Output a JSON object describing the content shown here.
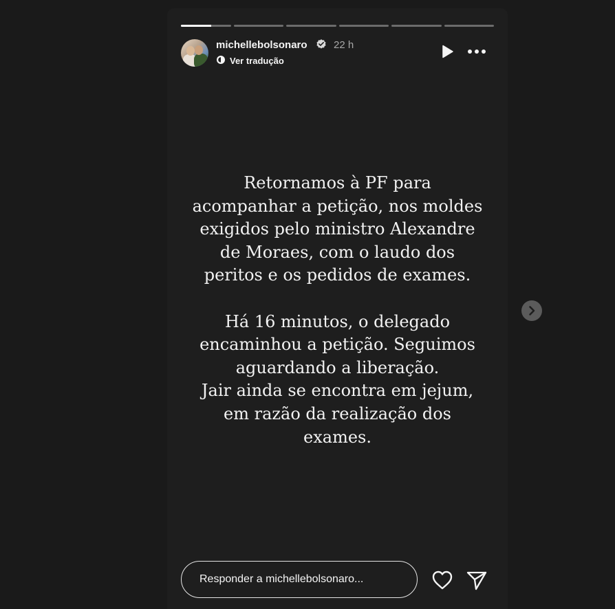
{
  "story": {
    "username": "michellebolsonaro",
    "verified": true,
    "time_ago": "22 h",
    "translate_label": "Ver tradução",
    "progress": {
      "segments": 6,
      "current_index": 0,
      "current_fraction": 0.6
    },
    "paragraphs": [
      "Retornamos à PF para\nacompanhar a petição, nos moldes\nexigidos pelo ministro Alexandre\nde Moraes, com o laudo dos\nperitos e os pedidos de exames.",
      "Há 16 minutos, o delegado\nencaminhou a petição. Seguimos\naguardando a liberação.\nJair ainda se encontra em jejum,\nem razão da realização dos\nexames."
    ],
    "reply_placeholder": "Responder a michellebolsonaro..."
  },
  "icons": {
    "verified": "verified-badge-icon",
    "translate": "translate-icon",
    "play": "play-icon",
    "more": "more-options-icon",
    "heart": "heart-icon",
    "send": "send-icon",
    "next": "chevron-right-icon"
  },
  "colors": {
    "background": "#1a1a1a",
    "story_background": "#1e1e1e",
    "text": "#f2f2f2",
    "muted": "#a8a8a8",
    "next_button": "#5b5b5b"
  }
}
